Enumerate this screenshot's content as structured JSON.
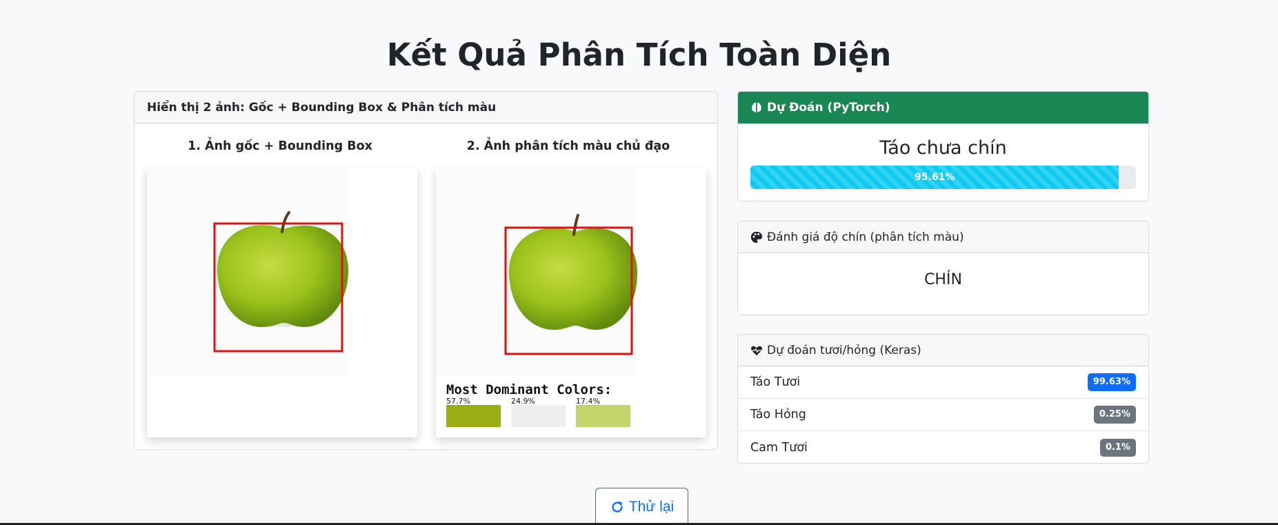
{
  "page": {
    "title": "Kết Quả Phân Tích Toàn Diện"
  },
  "left_card": {
    "header": "Hiển thị 2 ảnh: Gốc + Bounding Box & Phân tích màu",
    "col1_title": "1. Ảnh gốc + Bounding Box",
    "col2_title": "2. Ảnh phân tích màu chủ đạo",
    "dominant_colors": {
      "heading": "Most Dominant Colors:",
      "swatches": [
        {
          "percent": "57.7%",
          "color": "#9aad12"
        },
        {
          "percent": "24.9%",
          "color": "#eff0ee"
        },
        {
          "percent": "17.4%",
          "color": "#c3d56a"
        }
      ]
    }
  },
  "predict_card": {
    "header": "Dự Đoán (PyTorch)",
    "label": "Táo chưa chín",
    "confidence_text": "95.61%",
    "confidence_value": 95.61,
    "header_color": "#198754",
    "bar_color": "#0dcaf0"
  },
  "ripeness_card": {
    "header": "Đánh giá độ chín (phân tích màu)",
    "value": "CHÍN"
  },
  "keras_card": {
    "header": "Dự đoán tươi/hỏng (Keras)",
    "rows": [
      {
        "label": "Táo Tươi",
        "value": "99.63%",
        "badge_color": "#0d6efd"
      },
      {
        "label": "Táo Hỏng",
        "value": "0.25%",
        "badge_color": "#6c757d"
      },
      {
        "label": "Cam Tươi",
        "value": "0.1%",
        "badge_color": "#6c757d"
      }
    ]
  },
  "actions": {
    "retry_label": "Thử lại"
  },
  "icons": {
    "predict": "brain-icon",
    "ripeness": "palette-icon",
    "keras": "heart-pulse-icon",
    "retry": "rotate-right-icon"
  }
}
